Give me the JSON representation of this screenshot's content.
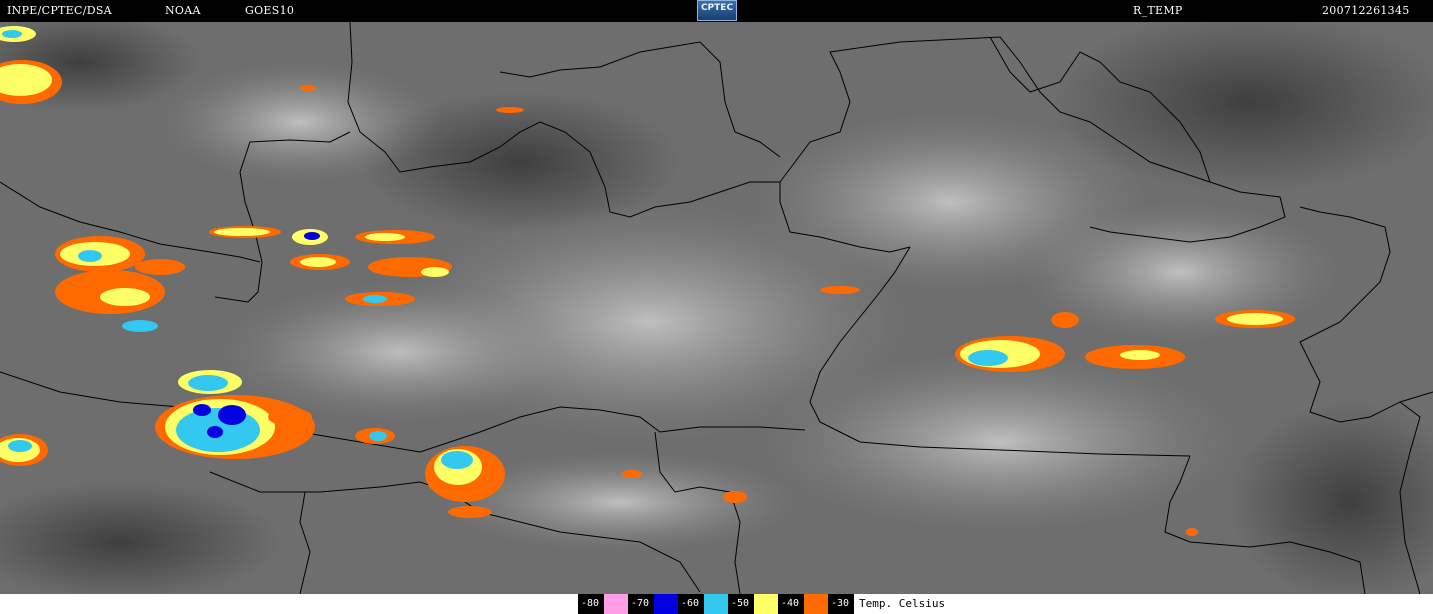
{
  "header": {
    "institution": "INPE/CPTEC/DSA",
    "agency": "NOAA",
    "satellite": "GOES10",
    "logo_text": "CPTEC",
    "product": "R_TEMP",
    "timestamp": "200712261345"
  },
  "legend": {
    "unit_label": "Temp. Celsius",
    "items": [
      {
        "label": "-80",
        "color": "#ff9ee6"
      },
      {
        "label": "-70",
        "color": "#0000e0"
      },
      {
        "label": "-60",
        "color": "#33c8f0"
      },
      {
        "label": "-50",
        "color": "#ffff66"
      },
      {
        "label": "-40",
        "color": "#ff6a00"
      },
      {
        "label": "-30",
        "color": null
      }
    ]
  }
}
